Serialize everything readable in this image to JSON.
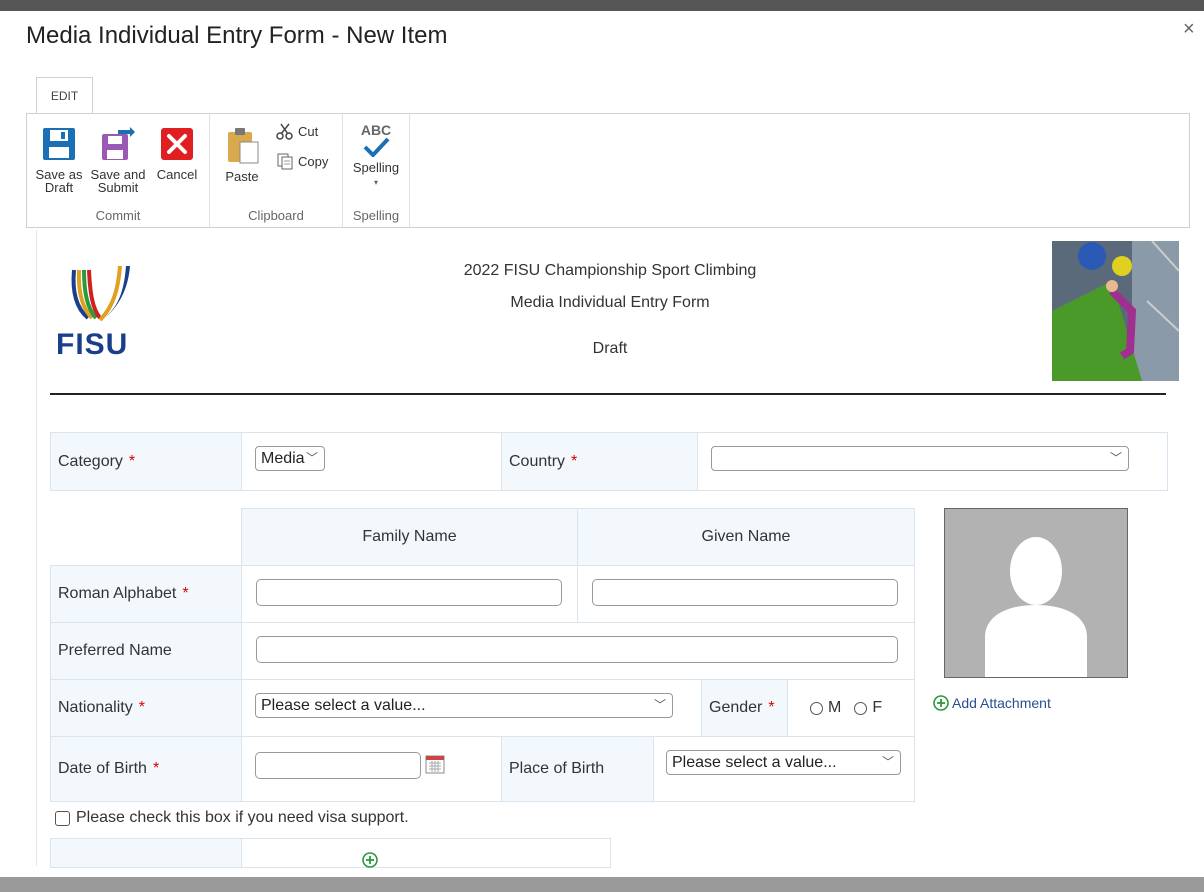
{
  "dialog": {
    "title": "Media Individual Entry Form - New Item",
    "close_glyph": "×"
  },
  "ribbon": {
    "tab": "EDIT",
    "commit": {
      "label": "Commit",
      "save_draft": [
        "Save as",
        "Draft"
      ],
      "save_submit": [
        "Save and",
        "Submit"
      ],
      "cancel": "Cancel"
    },
    "clipboard": {
      "label": "Clipboard",
      "paste": "Paste",
      "cut": "Cut",
      "copy": "Copy"
    },
    "spelling": {
      "label": "Spelling",
      "button": "Spelling",
      "abc": "ABC"
    }
  },
  "header": {
    "brand": "FISU",
    "line1": "2022 FISU Championship Sport Climbing",
    "line2": "Media Individual Entry Form",
    "status": "Draft"
  },
  "form": {
    "category": {
      "label": "Category",
      "value": "Media"
    },
    "country": {
      "label": "Country",
      "value": ""
    },
    "family_name_header": "Family Name",
    "given_name_header": "Given Name",
    "roman_alphabet": {
      "label": "Roman Alphabet"
    },
    "preferred_name": {
      "label": "Preferred Name"
    },
    "nationality": {
      "label": "Nationality",
      "value": "Please select a value..."
    },
    "gender": {
      "label": "Gender",
      "options": [
        "M",
        "F"
      ]
    },
    "date_of_birth": {
      "label": "Date of Birth"
    },
    "place_of_birth": {
      "label": "Place of Birth",
      "value": "Please select a value..."
    },
    "visa_support": "Please check this box if you need visa support.",
    "required_mark": "*",
    "add_attachment": "Add Attachment"
  },
  "colors": {
    "accent": "#1a6fb5",
    "required": "#dd0000",
    "link": "#2a4e8f",
    "label_bg": "#f3f8fc"
  }
}
